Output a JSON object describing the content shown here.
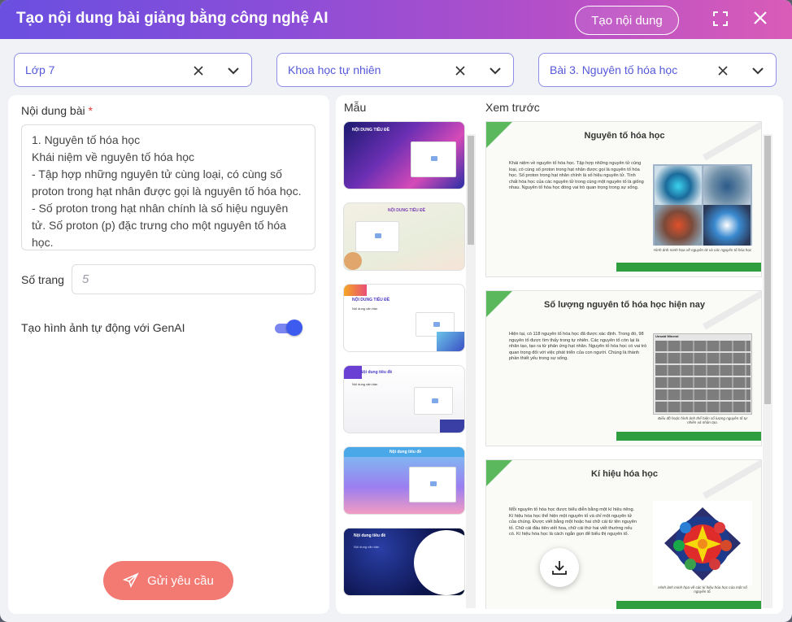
{
  "header": {
    "title": "Tạo nội dung bài giảng bằng công nghệ AI",
    "create_button": "Tạo nội dung",
    "accent": "#8a4ed8"
  },
  "selects": {
    "grade": "Lớp 7",
    "subject": "Khoa học tự nhiên",
    "lesson": "Bài 3. Nguyên tố hóa học"
  },
  "left": {
    "content_label": "Nội dung bài",
    "required_mark": "*",
    "content_text": "1. Nguyên tố hóa học\nKhái niệm về nguyên tố hóa học\n- Tập hợp những nguyên tử cùng loại, có cùng số proton trong hạt nhân được gọi là nguyên tố hóa học.\n- Số proton trong hạt nhân chính là số hiệu nguyên tử. Số proton (p) đặc trưng cho một nguyên tố hóa học.",
    "pages_label": "Số trang",
    "pages_placeholder": "5",
    "genai_label": "Tạo hình ảnh tự động với GenAI",
    "genai_enabled": true,
    "send_button": "Gửi yêu cầu",
    "send_color": "#f27a72"
  },
  "templates": {
    "label": "Mẫu",
    "items": [
      {
        "title": "NỘI DUNG TIÊU ĐỀ",
        "subtitle": ""
      },
      {
        "title": "NỘI DUNG TIÊU ĐỀ",
        "subtitle": ""
      },
      {
        "title": "NỘI DUNG TIÊU ĐỀ",
        "subtitle": "Nội dung văn bản"
      },
      {
        "title": "Nội dung tiêu đề",
        "subtitle": "Nội dung văn bản"
      },
      {
        "title": "Nội dung tiêu đề",
        "subtitle": ""
      },
      {
        "title": "Nội dung tiêu đề",
        "subtitle": "Nội dung văn bản"
      }
    ]
  },
  "preview": {
    "label": "Xem trước",
    "slides": [
      {
        "title": "Nguyên tố hóa học",
        "body": "Khái niệm về nguyên tố hóa học. Tập hợp những nguyên tử cùng loại, có cùng số proton trong hạt nhân được gọi là nguyên tố hóa học. Số proton trong hạt nhân chính là số hiệu nguyên tử. Tính chất hóa học của các nguyên tử trong cùng một nguyên tố là giống nhau. Nguyên tố hóa học đóng vai trò quan trọng trong sự sống.",
        "caption": "Hình ảnh minh họa về nguyên tử và các nguyên tố hóa học"
      },
      {
        "title": "Số lượng nguyên tố hóa học hiện nay",
        "body": "Hiện tại, có 118 nguyên tố hóa học đã được xác định. Trong đó, 98 nguyên tố được tìm thấy trong tự nhiên. Các nguyên tố còn lại là nhân tạo, tạo ra từ phản ứng hạt nhân. Nguyên tố hóa học có vai trò quan trọng đối với việc phát triển của con người. Chúng là thành phần thiết yếu trong sự sống.",
        "caption": "Biểu đồ hoặc hình ảnh thể hiện số lượng nguyên tố tự nhiên và nhân tạo."
      },
      {
        "title": "Kí hiệu hóa học",
        "body": "Mỗi nguyên tố hóa học được biểu diễn bằng một kí hiệu riêng. Kí hiệu hóa học thể hiện một nguyên tố và chỉ một nguyên tử của chúng. Được viết bằng một hoặc hai chữ cái từ tên nguyên tố. Chữ cái đầu tiên viết hoa, chữ cái thứ hai viết thường nếu có. Kí hiệu hóa học là cách ngắn gọn để biểu thị nguyên tố.",
        "caption": "Hình ảnh minh họa về các kí hiệu hóa học của một số nguyên tố."
      }
    ],
    "slide2_image_header": "Unsaid Mineral"
  }
}
